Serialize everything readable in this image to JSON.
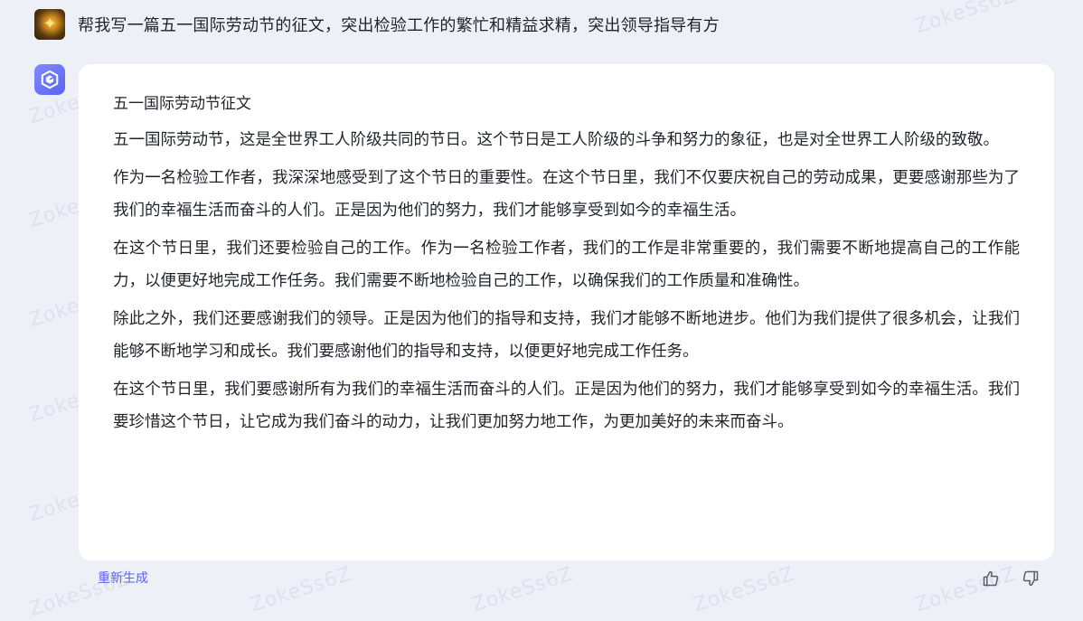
{
  "user_message": {
    "text": "帮我写一篇五一国际劳动节的征文，突出检验工作的繁忙和精益求精，突出领导指导有方",
    "avatar_icon": "user-avatar-icon"
  },
  "response": {
    "bot_icon": "bot-logo-icon",
    "title": "五一国际劳动节征文",
    "paragraphs": [
      "五一国际劳动节，这是全世界工人阶级共同的节日。这个节日是工人阶级的斗争和努力的象征，也是对全世界工人阶级的致敬。",
      "作为一名检验工作者，我深深地感受到了这个节日的重要性。在这个节日里，我们不仅要庆祝自己的劳动成果，更要感谢那些为了我们的幸福生活而奋斗的人们。正是因为他们的努力，我们才能够享受到如今的幸福生活。",
      "在这个节日里，我们还要检验自己的工作。作为一名检验工作者，我们的工作是非常重要的，我们需要不断地提高自己的工作能力，以便更好地完成工作任务。我们需要不断地检验自己的工作，以确保我们的工作质量和准确性。",
      "除此之外，我们还要感谢我们的领导。正是因为他们的指导和支持，我们才能够不断地进步。他们为我们提供了很多机会，让我们能够不断地学习和成长。我们要感谢他们的指导和支持，以便更好地完成工作任务。",
      "在这个节日里，我们要感谢所有为我们的幸福生活而奋斗的人们。正是因为他们的努力，我们才能够享受到如今的幸福生活。我们要珍惜这个节日，让它成为我们奋斗的动力，让我们更加努力地工作，为更加美好的未来而奋斗。"
    ]
  },
  "actions": {
    "regenerate_label": "重新生成",
    "thumbs_up_icon": "thumbs-up-icon",
    "thumbs_down_icon": "thumbs-down-icon"
  },
  "watermark": {
    "text": "ZokeSs6Z"
  },
  "colors": {
    "background": "#eef0f8",
    "card": "#ffffff",
    "accent": "#5965e8",
    "text": "#1f2329"
  }
}
